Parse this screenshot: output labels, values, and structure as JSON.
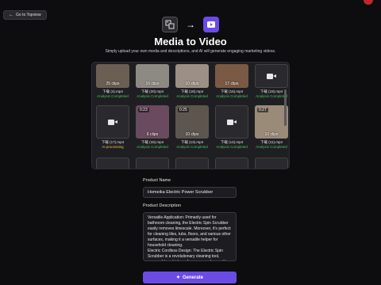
{
  "nav": {
    "back_label": "Go to Topview"
  },
  "header": {
    "title": "Media to Video",
    "subtitle": "Simply upload your own media and descriptions, and AI will generate engaging marketing videos."
  },
  "gallery": {
    "row1": [
      {
        "clips": "25 clips",
        "file": "下载 (4).mp4",
        "status": "Analysis Completed",
        "thumb": "#6b5e52"
      },
      {
        "clips": "16 clips",
        "file": "下载 (20).mp4",
        "status": "Analysis Completed",
        "thumb": "#8d8a84"
      },
      {
        "clips": "10 clips",
        "file": "下载 (18).mp4",
        "status": "Analysis Completed",
        "thumb": "#9c8f84"
      },
      {
        "clips": "17 clips",
        "file": "下载 (16).mp4",
        "status": "Analysis Completed",
        "thumb": "#7a5a44"
      },
      {
        "clips": "",
        "file": "下载 (19).mp4",
        "status": "Analysis Completed",
        "thumb": ""
      }
    ],
    "row2": [
      {
        "duration": "",
        "clips": "",
        "file": "下载 (17).mp4",
        "status": "AI processing",
        "thumb": ""
      },
      {
        "duration": "0:23",
        "clips": "6 clips",
        "file": "下载 (15).mp4",
        "status": "Analysis Completed",
        "thumb": "#6a4a5e"
      },
      {
        "duration": "0:25",
        "clips": "10 clips",
        "file": "下载 (13).mp4",
        "status": "Analysis Completed",
        "thumb": "#5d564f"
      },
      {
        "duration": "",
        "clips": "",
        "file": "下载 (14).mp4",
        "status": "Analysis Completed",
        "thumb": ""
      },
      {
        "duration": "0:27",
        "clips": "10 clips",
        "file": "下载 (11).mp4",
        "status": "Analysis Completed",
        "thumb": "#9a8a78"
      }
    ]
  },
  "form": {
    "product_name_label": "Product Name",
    "product_name_value": "Homeika Electric Power Scrubber",
    "product_desc_label": "Product Description",
    "product_desc_value": "Versatile Application: Primarily used for bathroom cleaning, the Electric Spin Scrubber easily removes limescale. Moreover, it's perfect for cleaning tiles, tubs, floors, and various other surfaces, making it a versatile helper for household cleaning.\nElectric Cordless Design: The Electric Spin Scrubber is a revolutionary cleaning tool, powered by a high-performance rechargeable lithium battery. Its cordless design allows"
  },
  "actions": {
    "generate_label": "Generate"
  }
}
